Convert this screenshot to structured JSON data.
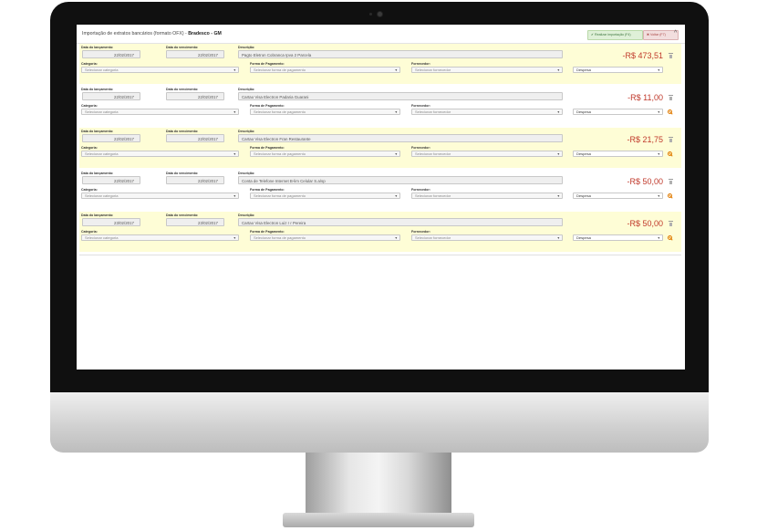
{
  "header": {
    "title_prefix": "Importação de extratos bancários (formato OFX) - ",
    "title_account": "Bradesco - GM",
    "import_button": "✔ Realizar importação (F4)",
    "back_button": "✖ Voltar (F7)",
    "collapse_icon": "^"
  },
  "labels": {
    "launch_date": "Data do lançamento:",
    "due_date": "Data do vencimento:",
    "description": "Descrição:",
    "category": "Categoria:",
    "payment_method": "Forma de Pagamento:",
    "supplier": "Fornecedor:"
  },
  "placeholders": {
    "category": "Selecionar categoria",
    "payment_method": "Selecionar forma de pagamento",
    "supplier": "Selecionar fornecedor"
  },
  "entries": [
    {
      "launch_date": "22/02/2017",
      "due_date": "22/02/2017",
      "description": "Pagto Eletron Cobranca Ipva 2 Parcela",
      "amount": "-R$ 473,51",
      "type": "Despesa",
      "highlight": "yellow",
      "action_icon": "trash-icon"
    },
    {
      "launch_date": "22/02/2017",
      "due_date": "22/02/2017",
      "description": "Cartao Visa Electron Padaria Guarani",
      "amount": "-R$ 11,00",
      "type": "Despesa",
      "highlight": "white",
      "action_icon": "ban-icon"
    },
    {
      "launch_date": "22/02/2017",
      "due_date": "22/02/2017",
      "description": "Cartao Visa Electron Fran Restaurante",
      "amount": "-R$ 21,75",
      "type": "Despesa",
      "highlight": "yellow",
      "action_icon": "ban-icon"
    },
    {
      "launch_date": "22/02/2017",
      "due_date": "22/02/2017",
      "description": "Conta de Telefone Internet B-lim Celular S.a/sp",
      "amount": "-R$ 50,00",
      "type": "Despesa",
      "highlight": "white",
      "action_icon": "ban-icon"
    },
    {
      "launch_date": "23/02/2017",
      "due_date": "23/02/2017",
      "description": "Cartao Visa Electron Luiz r r Pereira",
      "amount": "-R$ 50,00",
      "type": "Despesa",
      "highlight": "yellow",
      "action_icon": "ban-icon"
    }
  ],
  "colors": {
    "highlight_row": "#fefdd6",
    "amount_negative": "#c0392b",
    "import_button_bg": "#dff0d8",
    "back_button_bg": "#f2dede",
    "ignore_icon": "#e07b00"
  }
}
